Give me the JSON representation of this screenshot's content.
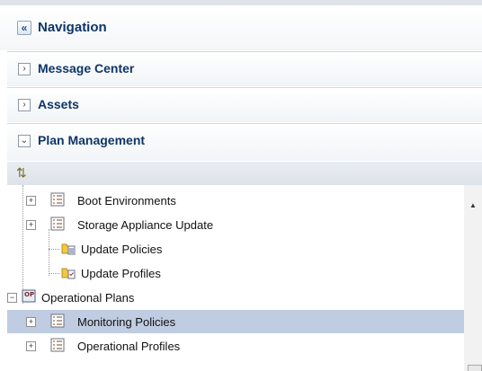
{
  "navigation": {
    "title": "Navigation",
    "collapse_icon": "double-chevron-left-icon"
  },
  "accordion": [
    {
      "label": "Message Center",
      "expanded": false
    },
    {
      "label": "Assets",
      "expanded": false
    },
    {
      "label": "Plan Management",
      "expanded": true
    }
  ],
  "toolbar": {
    "refresh_icon": "refresh-icon"
  },
  "tree": {
    "boot_env": "Boot Environments",
    "storage_update": "Storage Appliance Update",
    "update_policies": "Update Policies",
    "update_profiles": "Update Profiles",
    "operational_plans": "Operational Plans",
    "monitoring_policies": "Monitoring Policies",
    "operational_profiles": "Operational Profiles"
  },
  "colors": {
    "selected_row": "#bfcce1",
    "title": "#0e3566"
  }
}
